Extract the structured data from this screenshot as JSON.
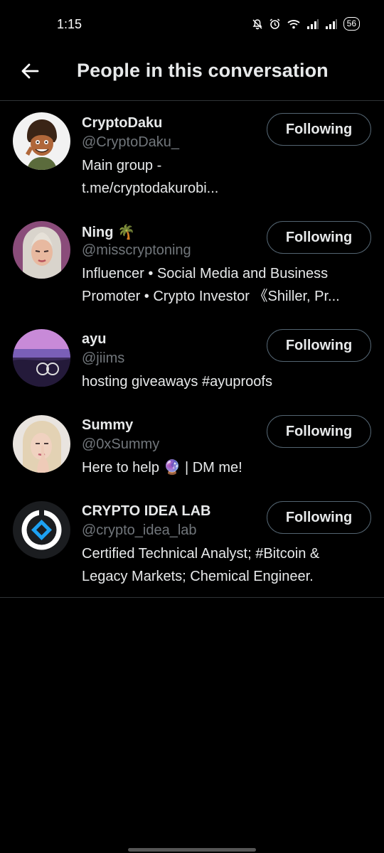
{
  "status_bar": {
    "time": "1:15",
    "battery": "56",
    "icons": [
      "bell-muted-icon",
      "alarm-icon",
      "wifi-icon",
      "signal-icon",
      "signal-icon",
      "battery-icon"
    ]
  },
  "header": {
    "title": "People in this conversation",
    "back_icon": "arrow-left-icon"
  },
  "users": [
    {
      "name": "CryptoDaku",
      "handle": "@CryptoDaku_",
      "bio_lines": [
        "Main group -",
        "t.me/cryptodakurobi..."
      ],
      "button": "Following"
    },
    {
      "name": "Ning 🌴",
      "handle": "@misscryptoning",
      "bio_lines": [
        "Influencer • Social Media and Business",
        "Promoter • Crypto Investor 《Shiller, Pr..."
      ],
      "button": "Following"
    },
    {
      "name": "ayu",
      "handle": "@jiims",
      "bio_lines": [
        "hosting giveaways #ayuproofs"
      ],
      "button": "Following"
    },
    {
      "name": "Summy",
      "handle": "@0xSummy",
      "bio_lines": [
        "Here to help 🔮 | DM me!"
      ],
      "button": "Following"
    },
    {
      "name": "CRYPTO IDEA LAB",
      "handle": "@crypto_idea_lab",
      "bio_lines": [
        "Certified Technical Analyst; #Bitcoin &",
        "Legacy Markets; Chemical Engineer."
      ],
      "button": "Following"
    }
  ],
  "colors": {
    "background": "#000000",
    "text_primary": "#e7e9ea",
    "text_secondary": "#71767b",
    "divider": "#2f3336",
    "button_border": "#536471",
    "accent_logo": "#1da1f2"
  }
}
